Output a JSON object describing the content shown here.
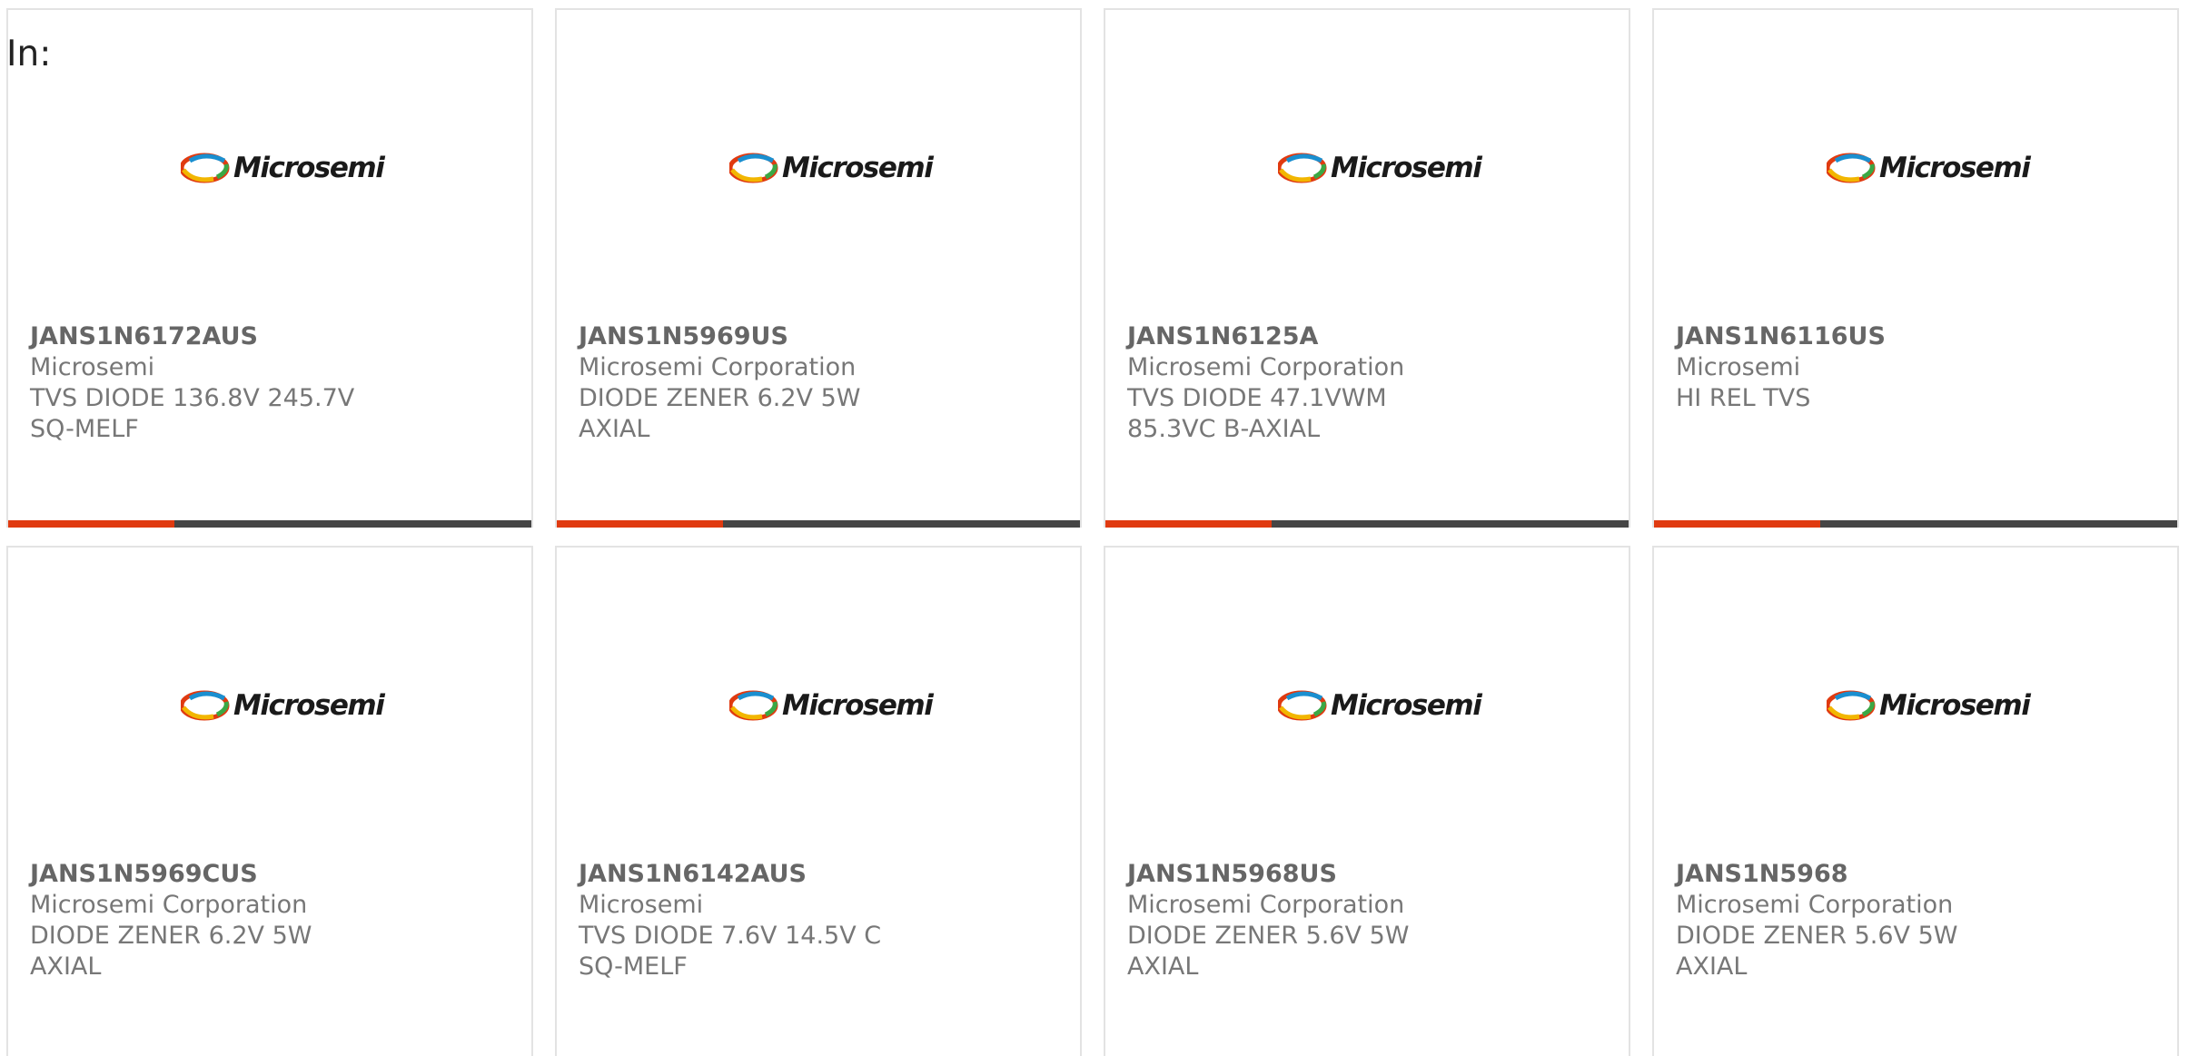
{
  "header": {
    "label": "In:"
  },
  "brand": {
    "logo_text": "Microsemi"
  },
  "colors": {
    "accent": "#e03a10",
    "bar": "#454545",
    "text": "#777777",
    "border": "#e3e3e3"
  },
  "products": [
    {
      "part": "JANS1N6172AUS",
      "manufacturer": "Microsemi",
      "description": "TVS DIODE 136.8V 245.7V SQ-MELF"
    },
    {
      "part": "JANS1N5969US",
      "manufacturer": "Microsemi Corporation",
      "description": "DIODE ZENER 6.2V 5W AXIAL"
    },
    {
      "part": "JANS1N6125A",
      "manufacturer": "Microsemi Corporation",
      "description": "TVS DIODE 47.1VWM 85.3VC B-AXIAL"
    },
    {
      "part": "JANS1N6116US",
      "manufacturer": "Microsemi",
      "description": "HI REL TVS"
    },
    {
      "part": "JANS1N5969CUS",
      "manufacturer": "Microsemi Corporation",
      "description": "DIODE ZENER 6.2V 5W AXIAL"
    },
    {
      "part": "JANS1N6142AUS",
      "manufacturer": "Microsemi",
      "description": "TVS DIODE 7.6V 14.5V C SQ-MELF"
    },
    {
      "part": "JANS1N5968US",
      "manufacturer": "Microsemi Corporation",
      "description": "DIODE ZENER 5.6V 5W AXIAL"
    },
    {
      "part": "JANS1N5968",
      "manufacturer": "Microsemi Corporation",
      "description": "DIODE ZENER 5.6V 5W AXIAL"
    }
  ]
}
